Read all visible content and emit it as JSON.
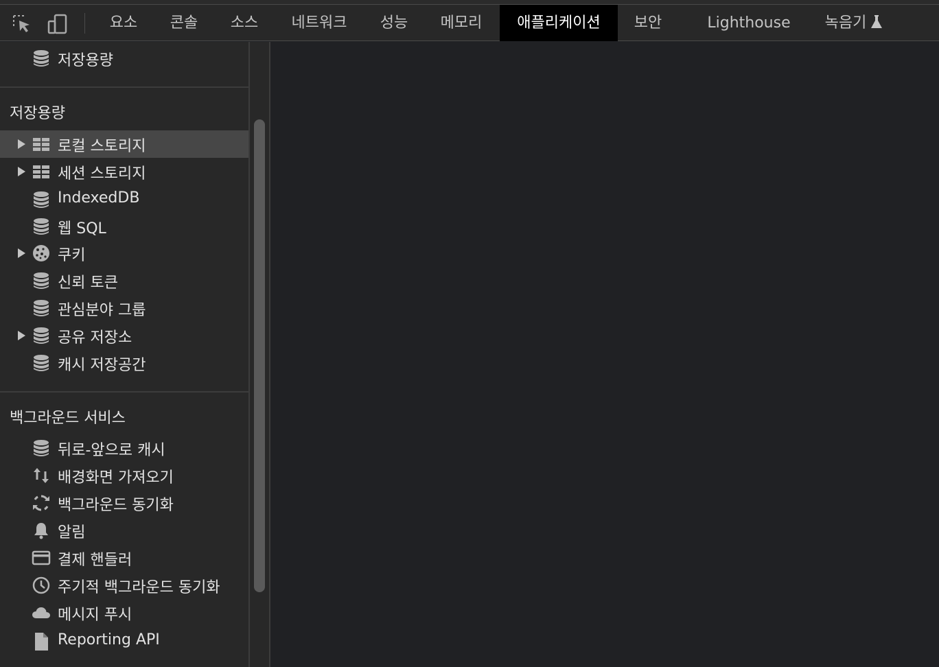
{
  "toolbar": {
    "tabs": [
      {
        "label": "요소"
      },
      {
        "label": "콘솔"
      },
      {
        "label": "소스"
      },
      {
        "label": "네트워크"
      },
      {
        "label": "성능"
      },
      {
        "label": "메모리"
      },
      {
        "label": "애플리케이션"
      },
      {
        "label": "보안"
      },
      {
        "label": "Lighthouse"
      },
      {
        "label": "녹음기"
      }
    ],
    "active_tab": "애플리케이션"
  },
  "sidebar": {
    "top_item": {
      "label": "저장용량",
      "icon": "database-icon"
    },
    "storage": {
      "title": "저장용량",
      "items": [
        {
          "label": "로컬 스토리지",
          "icon": "table-icon",
          "expandable": true,
          "selected": true
        },
        {
          "label": "세션 스토리지",
          "icon": "table-icon",
          "expandable": true
        },
        {
          "label": "IndexedDB",
          "icon": "database-icon"
        },
        {
          "label": "웹 SQL",
          "icon": "database-icon"
        },
        {
          "label": "쿠키",
          "icon": "cookie-icon",
          "expandable": true
        },
        {
          "label": "신뢰 토큰",
          "icon": "database-icon"
        },
        {
          "label": "관심분야 그룹",
          "icon": "database-icon"
        },
        {
          "label": "공유 저장소",
          "icon": "database-icon",
          "expandable": true
        },
        {
          "label": "캐시 저장공간",
          "icon": "database-icon"
        }
      ]
    },
    "background_services": {
      "title": "백그라운드 서비스",
      "items": [
        {
          "label": "뒤로-앞으로 캐시",
          "icon": "database-icon"
        },
        {
          "label": "배경화면 가져오기",
          "icon": "sync-arrows-icon"
        },
        {
          "label": "백그라운드 동기화",
          "icon": "refresh-icon"
        },
        {
          "label": "알림",
          "icon": "bell-icon"
        },
        {
          "label": "결제 핸들러",
          "icon": "credit-card-icon"
        },
        {
          "label": "주기적 백그라운드 동기화",
          "icon": "clock-icon"
        },
        {
          "label": "메시지 푸시",
          "icon": "cloud-icon"
        },
        {
          "label": "Reporting API",
          "icon": "document-icon"
        }
      ]
    }
  },
  "colors": {
    "toolbar_bg": "#282828",
    "sidebar_bg": "#282828",
    "selected_bg": "#474747",
    "active_tab_bg": "#000000",
    "main_bg": "#202124"
  }
}
